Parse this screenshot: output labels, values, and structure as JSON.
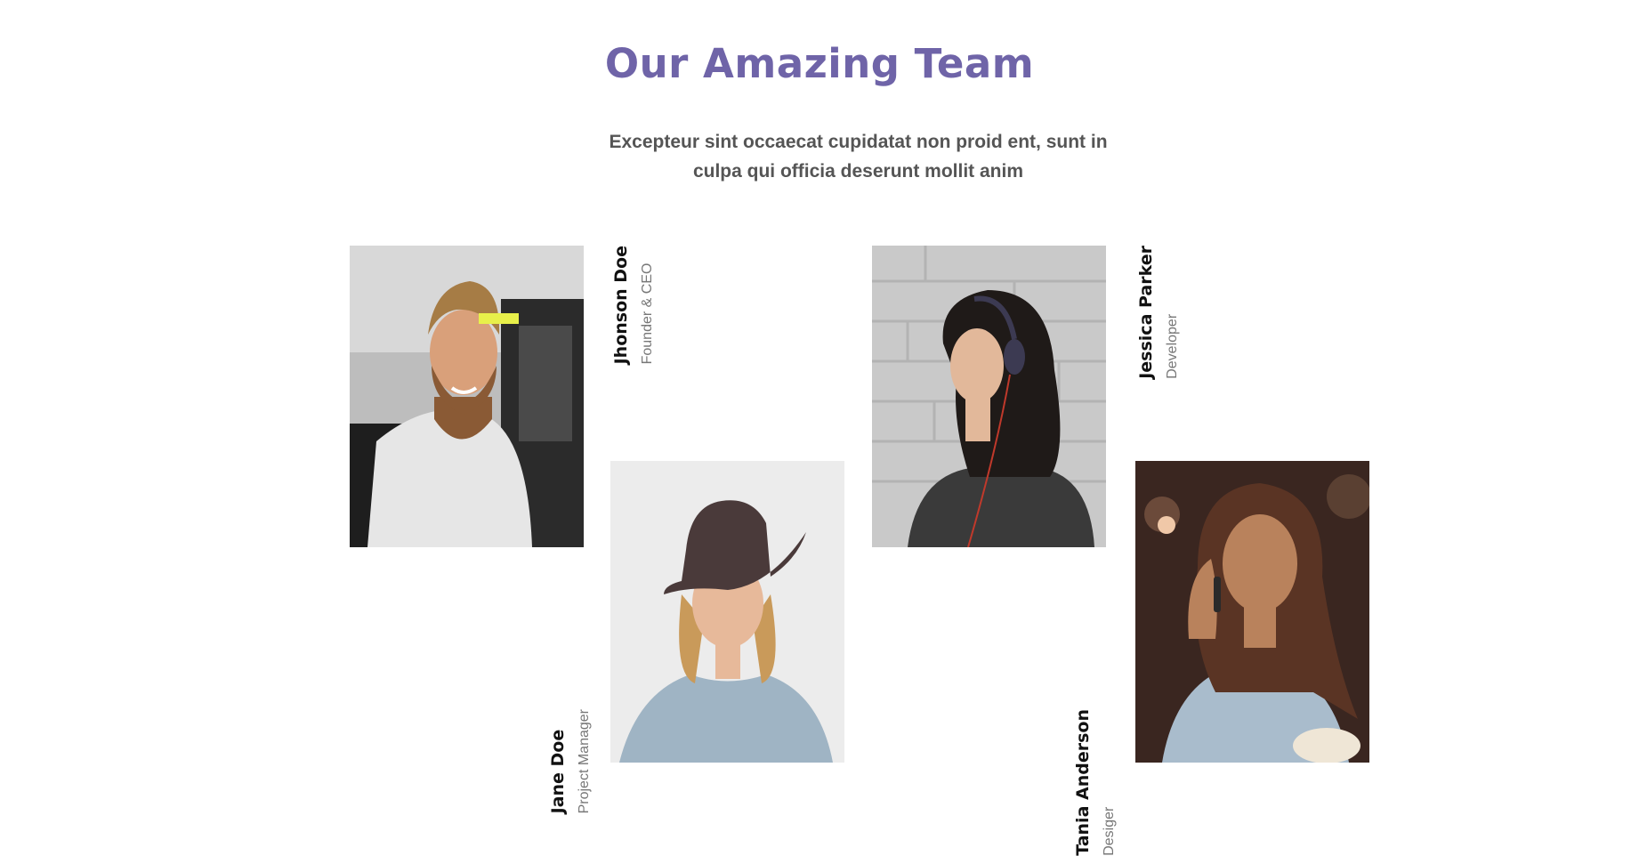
{
  "section": {
    "title": "Our Amazing Team",
    "subtitle": "Excepteur sint occaecat cupidatat non proid ent, sunt in culpa qui officia deserunt mollit anim"
  },
  "colors": {
    "accent": "#6f64a8",
    "subtitle": "#555555",
    "name": "#111111",
    "role": "#777777"
  },
  "team": [
    {
      "name": "Jhonson Doe",
      "role": "Founder & CEO",
      "photo_icon": "bearded-man-photo"
    },
    {
      "name": "Jane Doe",
      "role": "Project Manager",
      "photo_icon": "woman-in-hat-photo"
    },
    {
      "name": "Jessica Parker",
      "role": "Developer",
      "photo_icon": "woman-with-headphones-photo"
    },
    {
      "name": "Tania Anderson",
      "role": "Desiger",
      "photo_icon": "woman-on-phone-photo"
    }
  ]
}
